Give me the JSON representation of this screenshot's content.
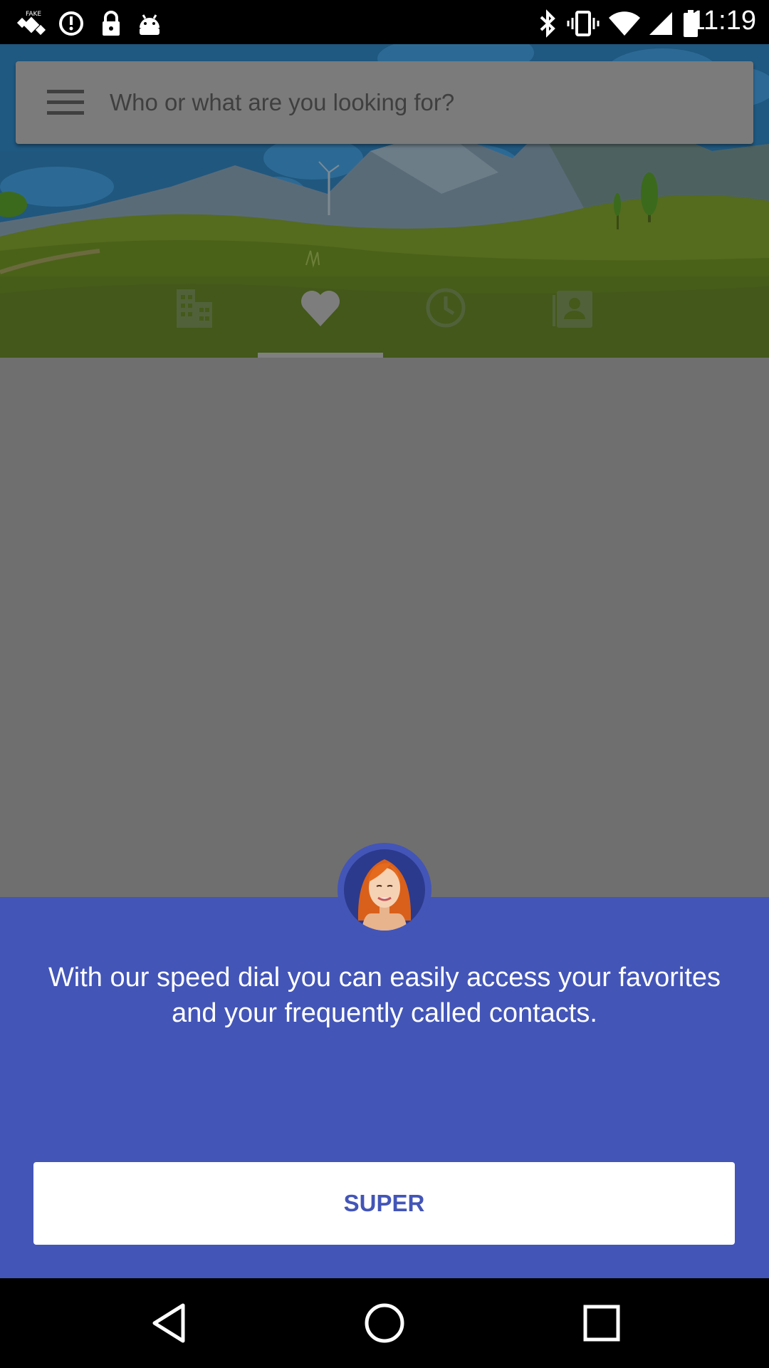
{
  "status_bar": {
    "time": "11:19",
    "left_icons": [
      "fake-gps-icon",
      "alarm-icon",
      "lock-icon",
      "android-icon"
    ],
    "right_icons": [
      "bluetooth-icon",
      "vibrate-icon",
      "wifi-icon",
      "signal-icon",
      "battery-icon"
    ]
  },
  "search": {
    "placeholder": "Who or what are you looking for?",
    "menu_icon": "hamburger-menu-icon"
  },
  "tabs": [
    {
      "icon": "building-icon",
      "selected": false
    },
    {
      "icon": "heart-icon",
      "selected": true
    },
    {
      "icon": "clock-icon",
      "selected": false
    },
    {
      "icon": "contact-card-icon",
      "selected": false
    }
  ],
  "onboarding": {
    "avatar_icon": "woman-avatar-icon",
    "message": "With our speed dial you can easily access your favorites and your frequently called contacts.",
    "button_label": "SUPER"
  },
  "nav_bar": {
    "buttons": [
      "back-icon",
      "home-icon",
      "recents-icon"
    ]
  },
  "colors": {
    "card_background": "#4355b7",
    "dim_overlay": "#6f6f6f",
    "button_text": "#4355b7"
  }
}
